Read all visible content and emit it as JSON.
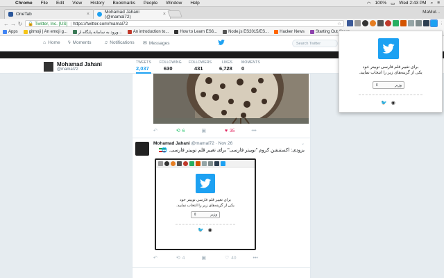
{
  "menubar": {
    "app": "Chrome",
    "items": [
      "File",
      "Edit",
      "View",
      "History",
      "Bookmarks",
      "People",
      "Window",
      "Help"
    ],
    "battery": "100%",
    "clock": "Wed 2:43 PM",
    "user": "MaMul..."
  },
  "tabs": [
    {
      "title": "OneTab",
      "color": "#2b579a"
    },
    {
      "title": "Mohamad Jahani (@mamal72)",
      "color": "#1da1f2"
    }
  ],
  "profile_button": "MaMul...",
  "address": {
    "secure_label": "Twitter, Inc. [US]",
    "url": "https://twitter.com/mamal72"
  },
  "bookmarks": [
    {
      "label": "Apps",
      "color": "#4285f4"
    },
    {
      "label": "gitmoji | An emoji g...",
      "color": "#f5c518"
    },
    {
      "label": "ورود به سامانه پایگاه ار...",
      "color": "#3b7a57"
    },
    {
      "label": "An introduction to...",
      "color": "#c0392b"
    },
    {
      "label": "How to Learn ES6...",
      "color": "#333333"
    },
    {
      "label": "Node.js ES2015/ES...",
      "color": "#555555"
    },
    {
      "label": "Hacker News",
      "color": "#ff6600"
    },
    {
      "label": "Starting Out (for re...",
      "color": "#8e44ad"
    }
  ],
  "twitter_nav": {
    "home": "Home",
    "moments": "Moments",
    "notifications": "Notifications",
    "messages": "Messages",
    "search_placeholder": "Search Twitter"
  },
  "profile": {
    "name": "Mohamad Jahani",
    "handle": "@mamal72",
    "stats": [
      {
        "label": "TWEETS",
        "value": "2,037"
      },
      {
        "label": "FOLLOWING",
        "value": "630"
      },
      {
        "label": "FOLLOWERS",
        "value": "431"
      },
      {
        "label": "LIKES",
        "value": "6,728"
      },
      {
        "label": "MOMENTS",
        "value": "0"
      }
    ]
  },
  "tweet1_actions": {
    "retweets": "6",
    "likes": "35"
  },
  "tweet2": {
    "name": "Mohamad Jahani",
    "handle": "@mamal72",
    "date": "· Nov 26",
    "text": "بزودی: اکستنشن کروم \"توییتر فارسی\" برای تغییر قلم توییتر فارسی. 🌐",
    "retweets": "4",
    "likes": "40"
  },
  "popup": {
    "line1": "برای تغییر قلم فارسی توییتر خود",
    "line2": "یکی از گزینه‌های زیر را انتخاب نمایید.",
    "select_value": "وزیر"
  },
  "colors": {
    "twitter_blue": "#1da1f2",
    "like_red": "#e0245e",
    "retweet_green": "#17bf63"
  }
}
